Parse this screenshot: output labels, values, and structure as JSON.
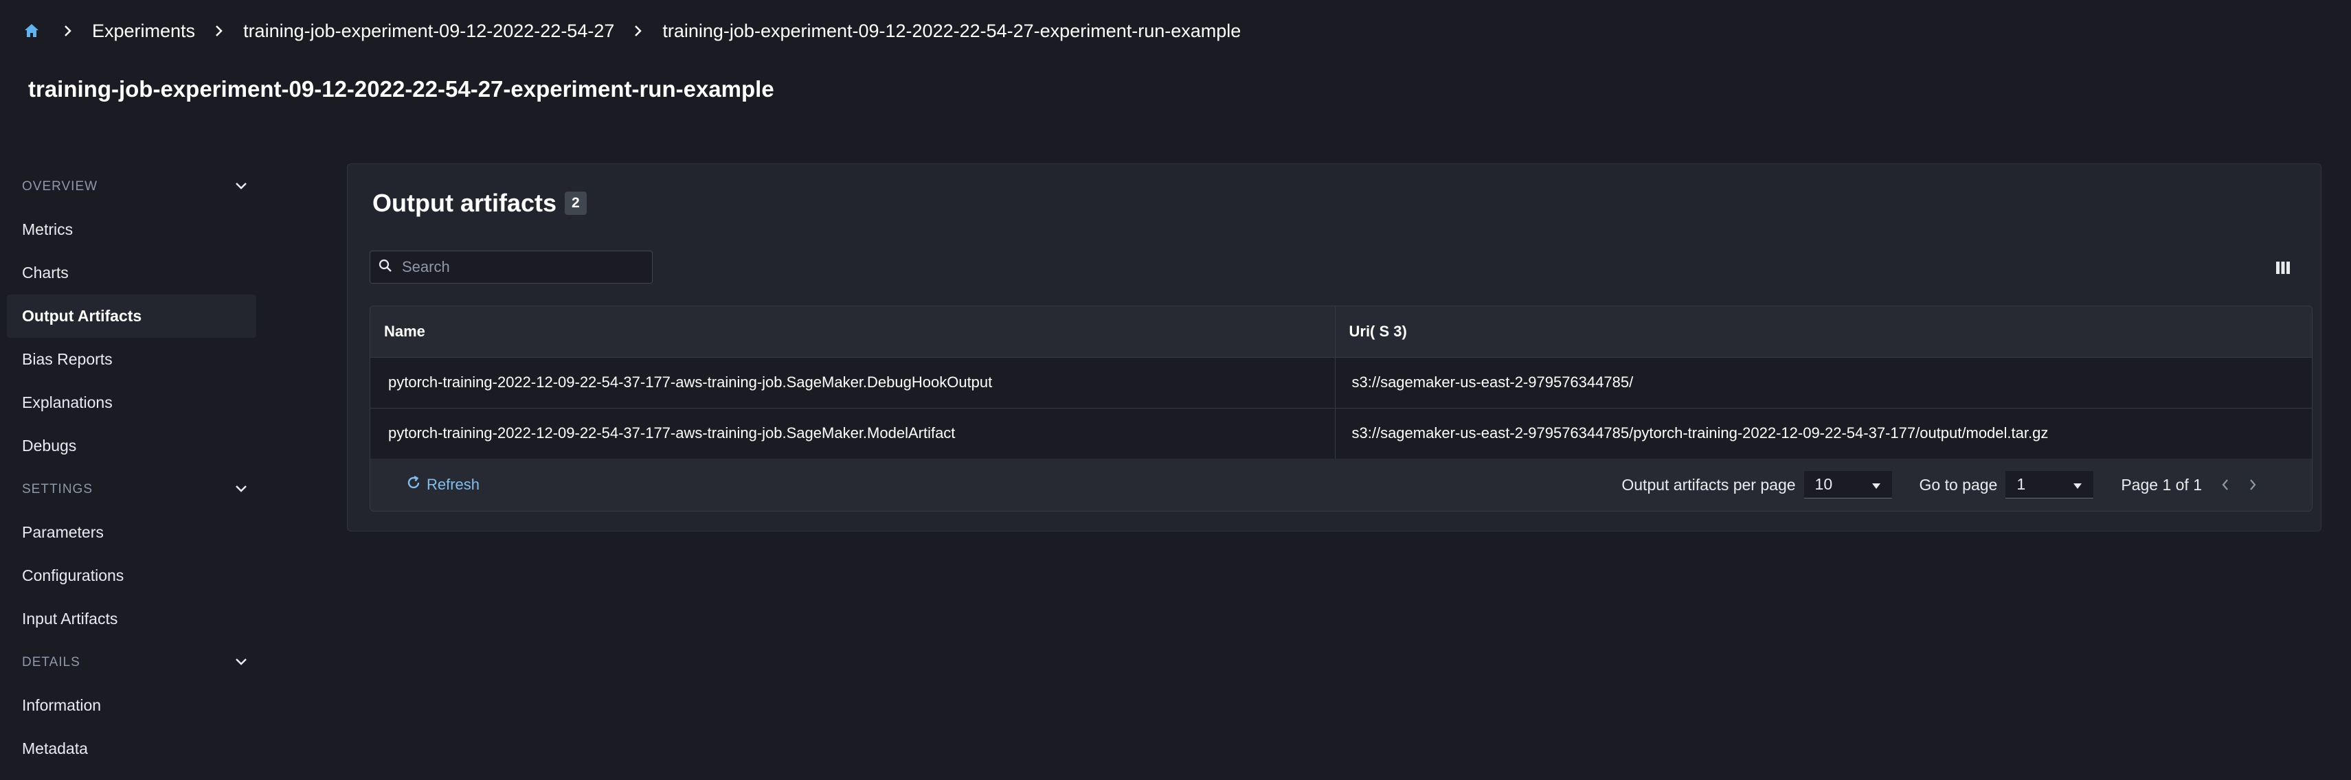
{
  "breadcrumbs": {
    "home_icon": "home-icon",
    "items": [
      "Experiments",
      "training-job-experiment-09-12-2022-22-54-27",
      "training-job-experiment-09-12-2022-22-54-27-experiment-run-example"
    ]
  },
  "page": {
    "title": "training-job-experiment-09-12-2022-22-54-27-experiment-run-example"
  },
  "sidebar": {
    "sections": [
      {
        "label": "OVERVIEW",
        "items": [
          "Metrics",
          "Charts",
          "Output Artifacts",
          "Bias Reports",
          "Explanations",
          "Debugs"
        ]
      },
      {
        "label": "SETTINGS",
        "items": [
          "Parameters",
          "Configurations",
          "Input Artifacts"
        ]
      },
      {
        "label": "DETAILS",
        "items": [
          "Information",
          "Metadata"
        ]
      }
    ],
    "active_item": "Output Artifacts"
  },
  "panel": {
    "title": "Output artifacts",
    "count": "2",
    "search_placeholder": "Search",
    "columns": [
      "Name",
      "Uri( S 3)"
    ],
    "rows": [
      {
        "name": "pytorch-training-2022-12-09-22-54-37-177-aws-training-job.SageMaker.DebugHookOutput",
        "uri": "s3://sagemaker-us-east-2-979576344785/"
      },
      {
        "name": "pytorch-training-2022-12-09-22-54-37-177-aws-training-job.SageMaker.ModelArtifact",
        "uri": "s3://sagemaker-us-east-2-979576344785/pytorch-training-2022-12-09-22-54-37-177/output/model.tar.gz"
      }
    ],
    "footer": {
      "refresh_label": "Refresh",
      "per_page_label": "Output artifacts per page",
      "per_page_value": "10",
      "goto_label": "Go to page",
      "goto_value": "1",
      "page_info": "Page 1 of 1"
    }
  },
  "colors": {
    "background": "#1b1c23",
    "panel": "#22252e",
    "link": "#7fbfef",
    "home_icon": "#5fb4f0"
  }
}
